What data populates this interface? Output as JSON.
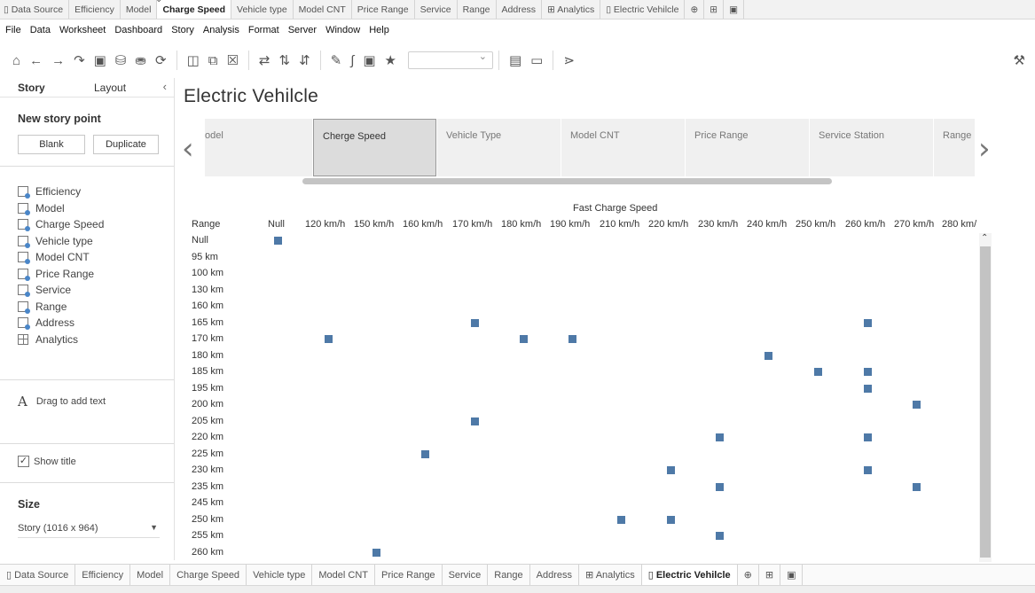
{
  "top_tabs": [
    {
      "label": "Data Source",
      "icon": "database-icon",
      "active": false
    },
    {
      "label": "Efficiency",
      "active": false
    },
    {
      "label": "Model",
      "active": false
    },
    {
      "label": "Charge Speed",
      "active": true
    },
    {
      "label": "Vehicle type",
      "active": false
    },
    {
      "label": "Model CNT",
      "active": false
    },
    {
      "label": "Price Range",
      "active": false
    },
    {
      "label": "Service",
      "active": false
    },
    {
      "label": "Range",
      "active": false
    },
    {
      "label": "Address",
      "active": false
    },
    {
      "label": "Analytics",
      "icon": "dashboard-icon",
      "active": false
    },
    {
      "label": "Electric Vehilcle",
      "icon": "story-icon",
      "active": false
    }
  ],
  "menu": [
    "File",
    "Data",
    "Worksheet",
    "Dashboard",
    "Story",
    "Analysis",
    "Format",
    "Server",
    "Window",
    "Help"
  ],
  "left_panel": {
    "tab_story": "Story",
    "tab_layout": "Layout",
    "new_story_point": "New story point",
    "blank_button": "Blank",
    "duplicate_button": "Duplicate",
    "sheets": [
      {
        "label": "Efficiency",
        "type": "worksheet"
      },
      {
        "label": "Model",
        "type": "worksheet"
      },
      {
        "label": "Charge Speed",
        "type": "worksheet"
      },
      {
        "label": "Vehicle type",
        "type": "worksheet"
      },
      {
        "label": "Model CNT",
        "type": "worksheet"
      },
      {
        "label": "Price Range",
        "type": "worksheet"
      },
      {
        "label": "Service",
        "type": "worksheet"
      },
      {
        "label": "Range",
        "type": "worksheet"
      },
      {
        "label": "Address",
        "type": "worksheet"
      },
      {
        "label": "Analytics",
        "type": "dashboard"
      }
    ],
    "drag_text": "Drag to add text",
    "drag_icon_glyph": "A",
    "show_title_label": "Show title",
    "show_title_checked": true,
    "size_heading": "Size",
    "size_value": "Story (1016 x 964)"
  },
  "story": {
    "title": "Electric Vehilcle",
    "points": [
      {
        "label": "odel",
        "active": false
      },
      {
        "label": "Cherge Speed",
        "active": true
      },
      {
        "label": "Vehicle Type",
        "active": false
      },
      {
        "label": "Model CNT",
        "active": false
      },
      {
        "label": "Price Range",
        "active": false
      },
      {
        "label": "Service Station",
        "active": false
      },
      {
        "label": "Range",
        "active": false
      }
    ]
  },
  "chart_data": {
    "type": "scatter",
    "title": "",
    "column_header_title": "Fast Charge Speed",
    "row_header_title": "Range",
    "mark_color": "#4e79a7",
    "x_categories": [
      "Null",
      "120 km/h",
      "150 km/h",
      "160 km/h",
      "170 km/h",
      "180 km/h",
      "190 km/h",
      "210 km/h",
      "220 km/h",
      "230 km/h",
      "240 km/h",
      "250 km/h",
      "260 km/h",
      "270 km/h",
      "280 km/"
    ],
    "y_categories": [
      "Null",
      "95 km",
      "100 km",
      "130 km",
      "160 km",
      "165 km",
      "170 km",
      "180 km",
      "185 km",
      "195 km",
      "200 km",
      "205 km",
      "220 km",
      "225 km",
      "230 km",
      "235 km",
      "245 km",
      "250 km",
      "255 km",
      "260 km"
    ],
    "points": [
      {
        "x": "Null",
        "y": "Null"
      },
      {
        "x": "170 km/h",
        "y": "165 km"
      },
      {
        "x": "260 km/h",
        "y": "165 km"
      },
      {
        "x": "120 km/h",
        "y": "170 km"
      },
      {
        "x": "180 km/h",
        "y": "170 km"
      },
      {
        "x": "190 km/h",
        "y": "170 km"
      },
      {
        "x": "240 km/h",
        "y": "180 km"
      },
      {
        "x": "250 km/h",
        "y": "185 km"
      },
      {
        "x": "260 km/h",
        "y": "185 km"
      },
      {
        "x": "260 km/h",
        "y": "195 km"
      },
      {
        "x": "270 km/h",
        "y": "200 km"
      },
      {
        "x": "170 km/h",
        "y": "205 km"
      },
      {
        "x": "230 km/h",
        "y": "220 km"
      },
      {
        "x": "260 km/h",
        "y": "220 km"
      },
      {
        "x": "160 km/h",
        "y": "225 km"
      },
      {
        "x": "220 km/h",
        "y": "230 km"
      },
      {
        "x": "260 km/h",
        "y": "230 km"
      },
      {
        "x": "230 km/h",
        "y": "235 km"
      },
      {
        "x": "270 km/h",
        "y": "235 km"
      },
      {
        "x": "210 km/h",
        "y": "250 km"
      },
      {
        "x": "220 km/h",
        "y": "250 km"
      },
      {
        "x": "230 km/h",
        "y": "255 km"
      },
      {
        "x": "150 km/h",
        "y": "260 km"
      }
    ]
  },
  "bottom_tabs": [
    {
      "label": "Data Source",
      "icon": "database-icon",
      "active": false
    },
    {
      "label": "Efficiency",
      "active": false
    },
    {
      "label": "Model",
      "active": false
    },
    {
      "label": "Charge Speed",
      "active": false
    },
    {
      "label": "Vehicle type",
      "active": false
    },
    {
      "label": "Model CNT",
      "active": false
    },
    {
      "label": "Price Range",
      "active": false
    },
    {
      "label": "Service",
      "active": false
    },
    {
      "label": "Range",
      "active": false
    },
    {
      "label": "Address",
      "active": false
    },
    {
      "label": "Analytics",
      "icon": "dashboard-icon",
      "active": false
    },
    {
      "label": "Electric Vehilcle",
      "icon": "story-icon",
      "active": true
    }
  ]
}
